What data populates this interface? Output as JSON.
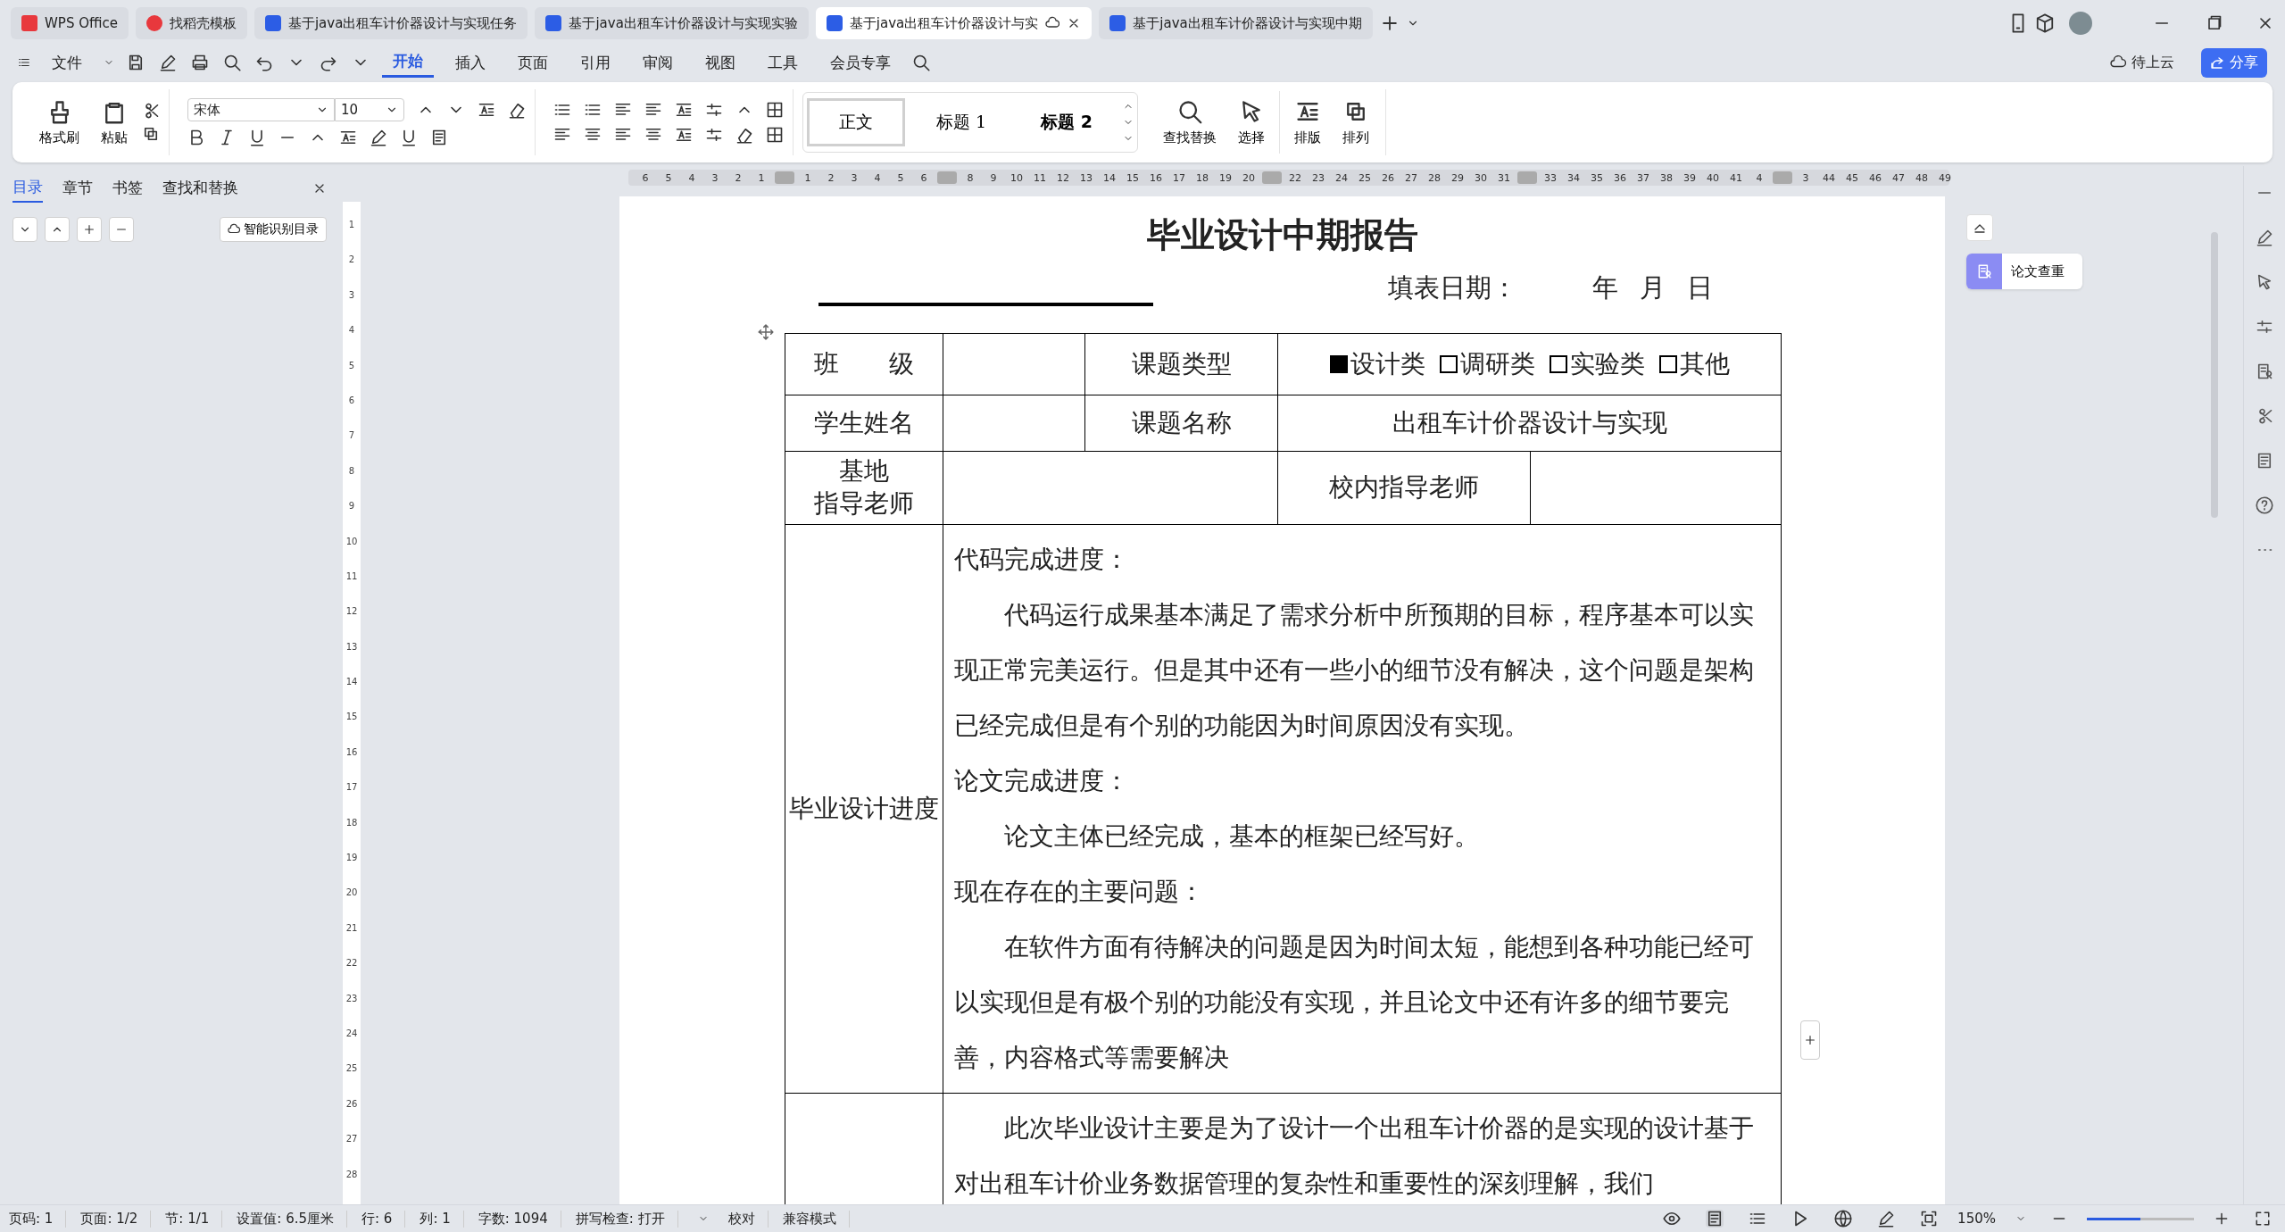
{
  "tabs": [
    {
      "label": "WPS Office",
      "kind": "home",
      "selected": false
    },
    {
      "label": "找稻壳模板",
      "kind": "template",
      "selected": false
    },
    {
      "label": "基于java出租车计价器设计与实现任务",
      "kind": "doc",
      "selected": false
    },
    {
      "label": "基于java出租车计价器设计与实现实验",
      "kind": "doc",
      "selected": false
    },
    {
      "label": "基于java出租车计价器设计与实",
      "kind": "doc",
      "selected": true
    },
    {
      "label": "基于java出租车计价器设计与实现中期",
      "kind": "doc",
      "selected": false
    }
  ],
  "menu": [
    {
      "label": "文件",
      "selected": false
    },
    {
      "label": "开始",
      "selected": true
    },
    {
      "label": "插入",
      "selected": false
    },
    {
      "label": "页面",
      "selected": false
    },
    {
      "label": "引用",
      "selected": false
    },
    {
      "label": "审阅",
      "selected": false
    },
    {
      "label": "视图",
      "selected": false
    },
    {
      "label": "工具",
      "selected": false
    },
    {
      "label": "会员专享",
      "selected": false
    }
  ],
  "cloud_status": "待上云",
  "share_button": "分享",
  "ribbon": {
    "format_painter": "格式刷",
    "paste": "粘贴",
    "font": "宋体",
    "font_size": "10",
    "styles": [
      {
        "label": "正文",
        "selected": true
      },
      {
        "label": "标题 1",
        "selected": false
      },
      {
        "label": "标题 2",
        "selected": false
      }
    ],
    "tools": [
      {
        "label": "查找替换",
        "kind": "find"
      },
      {
        "label": "选择",
        "kind": "select"
      },
      {
        "label": "排版",
        "kind": "layout"
      },
      {
        "label": "排列",
        "kind": "arrange"
      }
    ]
  },
  "nav_panel": {
    "tabs": [
      {
        "label": "目录",
        "selected": true
      },
      {
        "label": "章节",
        "selected": false
      },
      {
        "label": "书签",
        "selected": false
      },
      {
        "label": "查找和替换",
        "selected": false
      }
    ],
    "smart_toc_button": "智能识别目录"
  },
  "ruler": {
    "horizontal": [
      [
        "6",
        "5",
        "4",
        "3",
        "2",
        "1"
      ],
      [
        "1",
        "2",
        "3",
        "4",
        "5",
        "6"
      ],
      [
        "8",
        "9",
        "10",
        "11",
        "12",
        "13",
        "14",
        "15",
        "16",
        "17",
        "18",
        "19",
        "20"
      ],
      [
        "22",
        "23",
        "24",
        "25",
        "26",
        "27",
        "28",
        "29",
        "30",
        "31"
      ],
      [
        "33",
        "34",
        "35",
        "36",
        "37",
        "38",
        "39",
        "40",
        "41",
        "4"
      ],
      [
        "3",
        "44",
        "45",
        "46",
        "47",
        "48",
        "49"
      ]
    ],
    "vertical": [
      "1",
      "2",
      "3",
      "4",
      "5",
      "6",
      "7",
      "8",
      "9",
      "10",
      "11",
      "12",
      "13",
      "14",
      "15",
      "16",
      "17",
      "18",
      "19",
      "20",
      "21",
      "22",
      "23",
      "24",
      "25",
      "26",
      "27",
      "28"
    ]
  },
  "document": {
    "title": "毕业设计中期报告",
    "date_label": "填表日期：",
    "date_parts": [
      "年",
      "月",
      "日"
    ],
    "table": {
      "rows": [
        {
          "cells": [
            {
              "kind": "label",
              "lines": [
                "班　　级"
              ]
            },
            {
              "kind": "blank"
            },
            {
              "kind": "label",
              "lines": [
                "课题类型"
              ]
            },
            {
              "kind": "options",
              "options": [
                {
                  "label": "设计类",
                  "checked": true
                },
                {
                  "label": "调研类",
                  "checked": false
                },
                {
                  "label": "实验类",
                  "checked": false
                },
                {
                  "label": "其他",
                  "checked": false
                }
              ],
              "colspan": 2
            }
          ]
        },
        {
          "cells": [
            {
              "kind": "label",
              "lines": [
                "学生姓名"
              ]
            },
            {
              "kind": "blank"
            },
            {
              "kind": "label",
              "lines": [
                "课题名称"
              ]
            },
            {
              "kind": "value",
              "text": "出租车计价器设计与实现",
              "colspan": 2
            }
          ]
        },
        {
          "cells": [
            {
              "kind": "label",
              "lines": [
                "基地",
                "指导老师"
              ]
            },
            {
              "kind": "blank",
              "colspan": 2
            },
            {
              "kind": "label",
              "lines": [
                "校内指导老师"
              ]
            },
            {
              "kind": "blank"
            }
          ]
        },
        {
          "cells": [
            {
              "kind": "label",
              "lines": [
                "毕业设计进度"
              ]
            },
            {
              "kind": "content",
              "colspan": 4,
              "paragraphs": [
                {
                  "text": "代码完成进度：",
                  "indent": false
                },
                {
                  "text": "代码运行成果基本满足了需求分析中所预期的目标，程序基本可以实现正常完美运行。但是其中还有一些小的细节没有解决，这个问题是架构已经完成但是有个别的功能因为时间原因没有实现。",
                  "indent": true
                },
                {
                  "text": "论文完成进度：",
                  "indent": false
                },
                {
                  "text": "论文主体已经完成，基本的框架已经写好。",
                  "indent": true
                },
                {
                  "text": "现在存在的主要问题：",
                  "indent": false
                },
                {
                  "text": "在软件方面有待解决的问题是因为时间太短，能想到各种功能已经可以实现但是有极个别的功能没有实现，并且论文中还有许多的细节要完善，内容格式等需要解决",
                  "indent": true
                }
              ]
            }
          ]
        },
        {
          "cells": [
            {
              "kind": "blank"
            },
            {
              "kind": "content",
              "colspan": 4,
              "paragraphs": [
                {
                  "text": "此次毕业设计主要是为了设计一个出租车计价器的是实现的设计基于对出租车计价业务数据管理的复杂性和重要性的深刻理解，我们",
                  "indent": true
                }
              ]
            }
          ]
        }
      ]
    }
  },
  "side_tool": "论文查重",
  "status_bar": {
    "items": [
      "页码: 1",
      "页面: 1/2",
      "节: 1/1",
      "设置值: 6.5厘米",
      "行: 6",
      "列: 1",
      "字数: 1094",
      "拼写检查: 打开",
      "校对",
      "兼容模式"
    ],
    "zoom": "150%",
    "zoom_slider": {
      "level": 0.5
    }
  }
}
